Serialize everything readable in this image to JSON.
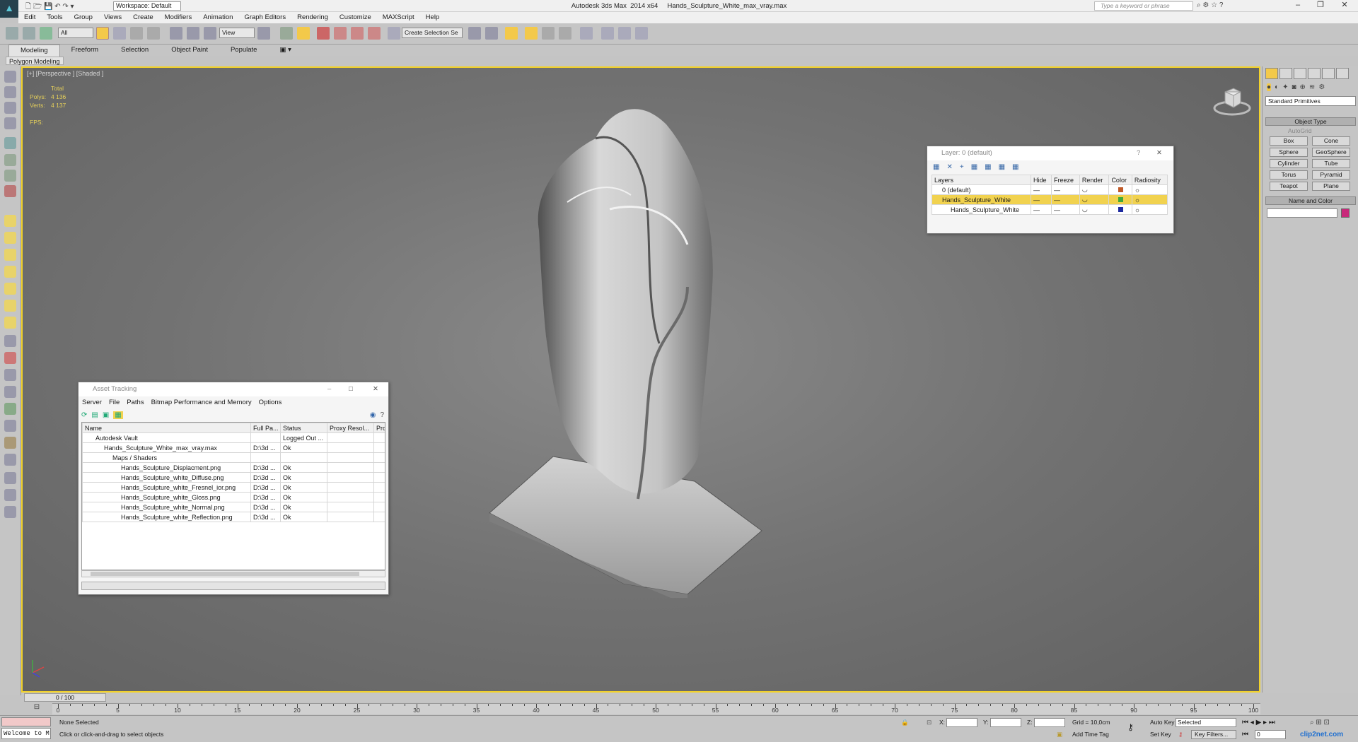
{
  "titlebar": {
    "app_title": "Autodesk 3ds Max  2014 x64     Hands_Sculpture_White_max_vray.max",
    "workspace": "Workspace: Default",
    "search_placeholder": "Type a keyword or phrase"
  },
  "menu": [
    "Edit",
    "Tools",
    "Group",
    "Views",
    "Create",
    "Modifiers",
    "Animation",
    "Graph Editors",
    "Rendering",
    "Customize",
    "MAXScript",
    "Help"
  ],
  "toolbar": {
    "filter": "All",
    "refcoord": "View",
    "selection_set": "Create Selection Se"
  },
  "ribbon": {
    "tabs": [
      "Modeling",
      "Freeform",
      "Selection",
      "Object Paint",
      "Populate"
    ],
    "panel": "Polygon Modeling"
  },
  "viewport": {
    "label": "[+] [Perspective ] [Shaded ]",
    "stats_header": "Total",
    "polys_label": "Polys:",
    "polys": "4 136",
    "verts_label": "Verts:",
    "verts": "4 137",
    "fps_label": "FPS:"
  },
  "command_panel": {
    "dropdown": "Standard Primitives",
    "object_type": "Object Type",
    "autogrid": "AutoGrid",
    "buttons": [
      "Box",
      "Cone",
      "Sphere",
      "GeoSphere",
      "Cylinder",
      "Tube",
      "Torus",
      "Pyramid",
      "Teapot",
      "Plane"
    ],
    "name_color": "Name and Color",
    "swatch_color": "#c8287a"
  },
  "layer_window": {
    "title": "Layer: 0 (default)",
    "help": "?",
    "columns": [
      "Layers",
      "Hide",
      "Freeze",
      "Render",
      "Color",
      "Radiosity"
    ],
    "rows": [
      {
        "name": "0 (default)",
        "color": "#c05a28",
        "current": true
      },
      {
        "name": "Hands_Sculpture_White",
        "color": "#3fa83a",
        "selected": true
      },
      {
        "name": "Hands_Sculpture_White",
        "color": "#1d2aa0"
      }
    ]
  },
  "asset_window": {
    "title": "Asset Tracking",
    "menu": [
      "Server",
      "File",
      "Paths",
      "Bitmap Performance and Memory",
      "Options"
    ],
    "columns": [
      "Name",
      "Full Pa...",
      "Status",
      "Proxy Resol...",
      "Prox"
    ],
    "rows": [
      {
        "name": "Autodesk Vault",
        "path": "",
        "status": "Logged Out ..."
      },
      {
        "name": "Hands_Sculpture_White_max_vray.max",
        "path": "D:\\3d ...",
        "status": "Ok"
      },
      {
        "name": "Maps / Shaders",
        "path": "",
        "status": ""
      },
      {
        "name": "Hands_Sculpture_Displacment.png",
        "path": "D:\\3d ...",
        "status": "Ok"
      },
      {
        "name": "Hands_Sculpture_white_Diffuse.png",
        "path": "D:\\3d ...",
        "status": "Ok"
      },
      {
        "name": "Hands_Sculpture_white_Fresnel_ior.png",
        "path": "D:\\3d ...",
        "status": "Ok"
      },
      {
        "name": "Hands_Sculpture_white_Gloss.png",
        "path": "D:\\3d ...",
        "status": "Ok"
      },
      {
        "name": "Hands_Sculpture_white_Normal.png",
        "path": "D:\\3d ...",
        "status": "Ok"
      },
      {
        "name": "Hands_Sculpture_white_Reflection.png",
        "path": "D:\\3d ...",
        "status": "Ok"
      }
    ]
  },
  "timeline": {
    "frame": "0 / 100",
    "ticks": [
      "0",
      "5",
      "10",
      "15",
      "20",
      "25",
      "30",
      "35",
      "40",
      "45",
      "50",
      "55",
      "60",
      "65",
      "70",
      "75",
      "80",
      "85",
      "90",
      "95",
      "100"
    ]
  },
  "status": {
    "selection": "None Selected",
    "prompt": "Click or click-and-drag to select objects",
    "maxscript": "Welcome to M",
    "x": "X:",
    "y": "Y:",
    "z": "Z:",
    "grid": "Grid = 10,0cm",
    "time_tag": "Add Time Tag",
    "auto_key": "Auto Key",
    "selected": "Selected",
    "set_key": "Set Key",
    "key_filters": "Key Filters...",
    "frame_field": "0",
    "watermark": "clip2net.com"
  }
}
